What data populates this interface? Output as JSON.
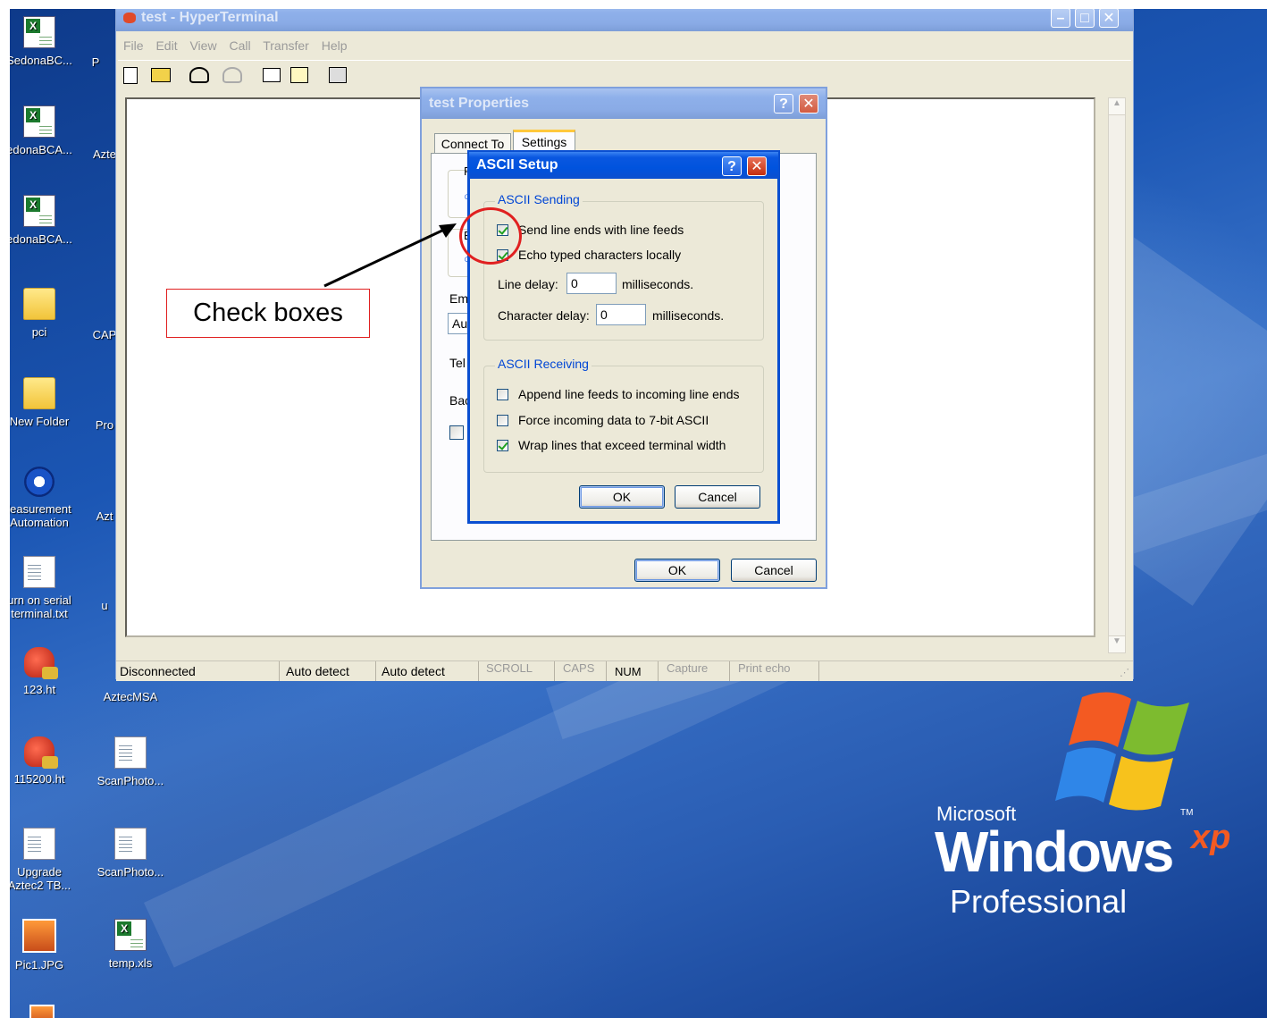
{
  "hyperterminal": {
    "title": "test - HyperTerminal",
    "menu": [
      "File",
      "Edit",
      "View",
      "Call",
      "Transfer",
      "Help"
    ],
    "toolbar_icons": [
      "new-icon",
      "open-icon",
      "connect-icon",
      "disconnect-icon",
      "send-icon",
      "receive-icon",
      "properties-icon"
    ],
    "status_bar": {
      "connection": "Disconnected",
      "detect1": "Auto detect",
      "detect2": "Auto detect",
      "scroll": "SCROLL",
      "caps": "CAPS",
      "num": "NUM",
      "capture": "Capture",
      "print_echo": "Print echo"
    }
  },
  "properties_dialog": {
    "title": "test Properties",
    "tabs": [
      "Connect To",
      "Settings"
    ],
    "partial_labels": {
      "f": "F",
      "b": "B",
      "em": "Em",
      "au": "Au",
      "tel": "Tel",
      "bac": "Bac"
    },
    "ok_label": "OK",
    "cancel_label": "Cancel"
  },
  "ascii_setup": {
    "title": "ASCII Setup",
    "sending_group": "ASCII Sending",
    "send_line_ends": {
      "label": "Send line ends with line feeds",
      "checked": true
    },
    "echo_typed": {
      "label": "Echo typed characters locally",
      "checked": true
    },
    "line_delay_label": "Line delay:",
    "line_delay_value": "0",
    "line_delay_unit": "milliseconds.",
    "char_delay_label": "Character delay:",
    "char_delay_value": "0",
    "char_delay_unit": "milliseconds.",
    "receiving_group": "ASCII Receiving",
    "append_line_feeds": {
      "label": "Append line feeds to incoming line ends",
      "checked": false
    },
    "force_7bit": {
      "label": "Force incoming data to 7-bit ASCII",
      "checked": false
    },
    "wrap_lines": {
      "label": "Wrap lines that exceed terminal width",
      "checked": true
    },
    "ok_label": "OK",
    "cancel_label": "Cancel"
  },
  "annotation": {
    "callout_text": "Check boxes",
    "circle_color": "#e02020",
    "arrow_color": "#000000"
  },
  "desktop_icons": [
    {
      "label": "SedonaBC...",
      "icon": "excel-icon"
    },
    {
      "label": "edonaBCA...",
      "icon": "excel-icon"
    },
    {
      "label": "edonaBCA...",
      "icon": "excel-icon"
    },
    {
      "label": "pci",
      "icon": "folder-icon"
    },
    {
      "label": "New Folder",
      "icon": "folder-icon"
    },
    {
      "label": "leasurement\n Automation",
      "icon": "ni-icon"
    },
    {
      "label": "urn on serial\nterminal.txt",
      "icon": "text-file-icon"
    },
    {
      "label": "123.ht",
      "icon": "hyperterminal-icon"
    },
    {
      "label": "115200.ht",
      "icon": "hyperterminal-icon"
    },
    {
      "label": "Upgrade\nAztec2 TB...",
      "icon": "text-file-icon"
    },
    {
      "label": "Pic1.JPG",
      "icon": "jpg-icon"
    }
  ],
  "desktop_icons_col2": [
    {
      "label": "P"
    },
    {
      "label": "Azte"
    },
    {
      "label": "CAP"
    },
    {
      "label": "Pro"
    },
    {
      "label": "Azt"
    },
    {
      "label": "u"
    },
    {
      "label": "AztecMSA",
      "icon": ""
    },
    {
      "label": "ScanPhoto...",
      "icon": "text-file-icon"
    },
    {
      "label": "ScanPhoto...",
      "icon": "text-file-icon"
    },
    {
      "label": "temp.xls",
      "icon": "excel-icon"
    }
  ],
  "branding": {
    "microsoft": "Microsoft",
    "windows": "Windows",
    "xp": "xp",
    "tm": "TM",
    "edition": "Professional"
  }
}
